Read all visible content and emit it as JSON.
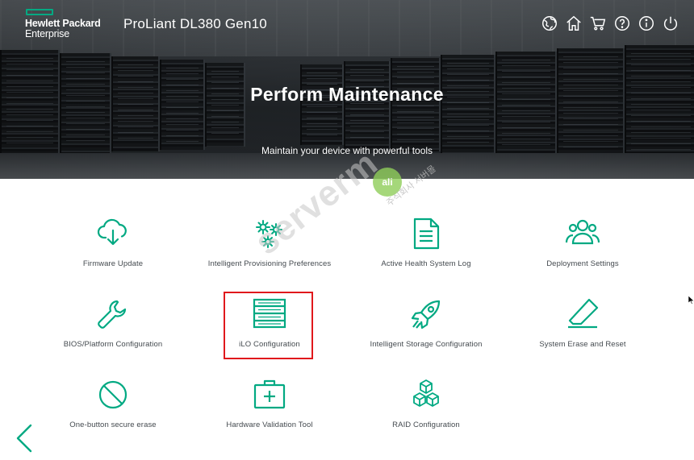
{
  "header": {
    "brand_line1": "Hewlett Packard",
    "brand_line2": "Enterprise",
    "product": "ProLiant DL380 Gen10",
    "icons": [
      "globe-icon",
      "home-icon",
      "cart-icon",
      "help-icon",
      "info-icon",
      "power-icon"
    ]
  },
  "hero": {
    "title": "Perform Maintenance",
    "subtitle": "Maintain your device with powerful tools"
  },
  "tiles": [
    {
      "label": "Firmware Update",
      "icon": "cloud-download-icon"
    },
    {
      "label": "Intelligent Provisioning Preferences",
      "icon": "gears-icon"
    },
    {
      "label": "Active Health System Log",
      "icon": "document-icon"
    },
    {
      "label": "Deployment Settings",
      "icon": "users-icon"
    },
    {
      "label": "BIOS/Platform Configuration",
      "icon": "wrench-icon"
    },
    {
      "label": "iLO Configuration",
      "icon": "server-rack-icon",
      "highlighted": true
    },
    {
      "label": "Intelligent Storage Configuration",
      "icon": "rocket-icon"
    },
    {
      "label": "System Erase and Reset",
      "icon": "eraser-icon"
    },
    {
      "label": "One-button secure erase",
      "icon": "prohibited-icon"
    },
    {
      "label": "Hardware Validation Tool",
      "icon": "first-aid-icon"
    },
    {
      "label": "RAID Configuration",
      "icon": "cubes-icon"
    }
  ],
  "watermark": {
    "main": "serverm",
    "badge": "ali",
    "small": "주식회사 서버몰"
  },
  "colors": {
    "accent": "#01a982",
    "highlight": "#e0181c",
    "label": "#444a4f"
  }
}
